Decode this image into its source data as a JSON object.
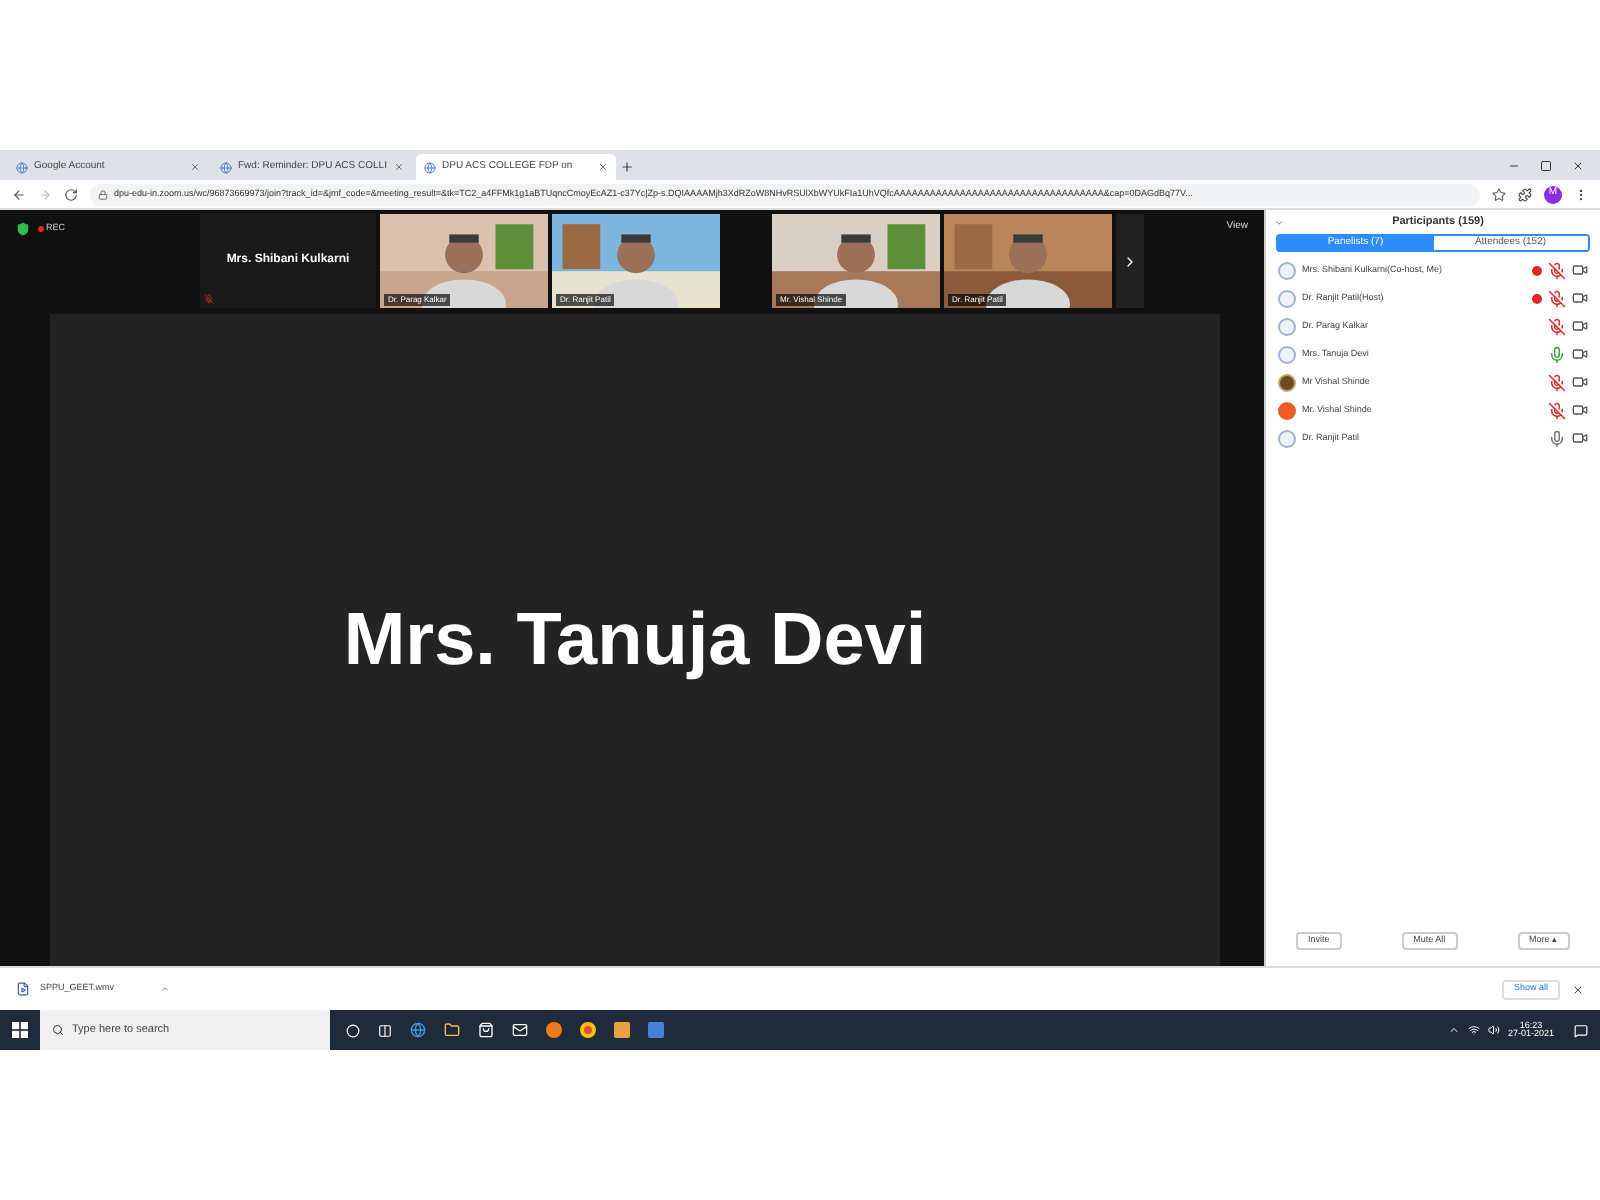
{
  "browser": {
    "tabs": [
      {
        "title": "Google Account",
        "selected": false
      },
      {
        "title": "Fwd: Reminder: DPU ACS COLLI",
        "selected": false
      },
      {
        "title": "DPU ACS COLLEGE FDP on",
        "selected": true
      }
    ],
    "url": "dpu-edu-in.zoom.us/wc/96873669973/join?track_id=&jmf_code=&meeting_result=&tk=TC2_a4FFMk1g1aBTUqncCmoyEcAZ1-c37Yc|Zp-s.DQIAAAAMjh3XdRZoW8NHvRSUlXbWYUkFIa1UhVQfcAAAAAAAAAAAAAAAAAAAAAAAAAAAAAAAAAAA&cap=0DAGdBq77V...",
    "profile": "M"
  },
  "meeting": {
    "recording": "REC",
    "view_label": "View",
    "videos": [
      {
        "name": "Mrs. Shibani Kulkarni",
        "kind": "name"
      },
      {
        "name": "Dr. Parag Kalkar",
        "kind": "picture"
      },
      {
        "name": "Dr. Ranjit Patil",
        "kind": "picture"
      },
      {
        "name": "Mr. Vishal Shinde",
        "kind": "picture"
      },
      {
        "name": "Dr. Ranjit Patil",
        "kind": "picture"
      }
    ],
    "active_speaker": "Mrs. Tanuja Devi"
  },
  "participants": {
    "title": "Participants (159)",
    "tabs": [
      {
        "label": "Panelists (7)",
        "selected": true
      },
      {
        "label": "Attendees (152)",
        "selected": false
      }
    ],
    "rows": [
      {
        "name": "Mrs. Shibani Kulkarni(Co-host, Me)",
        "kind": "default",
        "recording": true,
        "muted": true
      },
      {
        "name": "Dr. Ranjit Patil(Host)",
        "kind": "default",
        "recording": true,
        "muted": true
      },
      {
        "name": "Dr. Parag Kalkar",
        "kind": "default",
        "recording": false,
        "muted": true
      },
      {
        "name": "Mrs. Tanuja Devi",
        "kind": "default",
        "recording": false,
        "muted": false,
        "speaking": true
      },
      {
        "name": "Mr Vishal Shinde",
        "recording": false,
        "muted": true
      },
      {
        "name": "Mr. Vishal Shinde",
        "kind": "initial",
        "color": "#f05a28",
        "recording": false,
        "muted": true
      },
      {
        "name": "Dr. Ranjit Patil",
        "kind": "default",
        "recording": false,
        "muted": false,
        "speaking": false
      }
    ],
    "buttons": [
      "Invite",
      "Mute All",
      "More ▴"
    ]
  },
  "downloads": {
    "file": "SPPU_GEET.wmv",
    "show_all": "Show all"
  },
  "taskbar": {
    "search_placeholder": "Type here to search",
    "time": "16:23",
    "date": "27-01-2021"
  }
}
